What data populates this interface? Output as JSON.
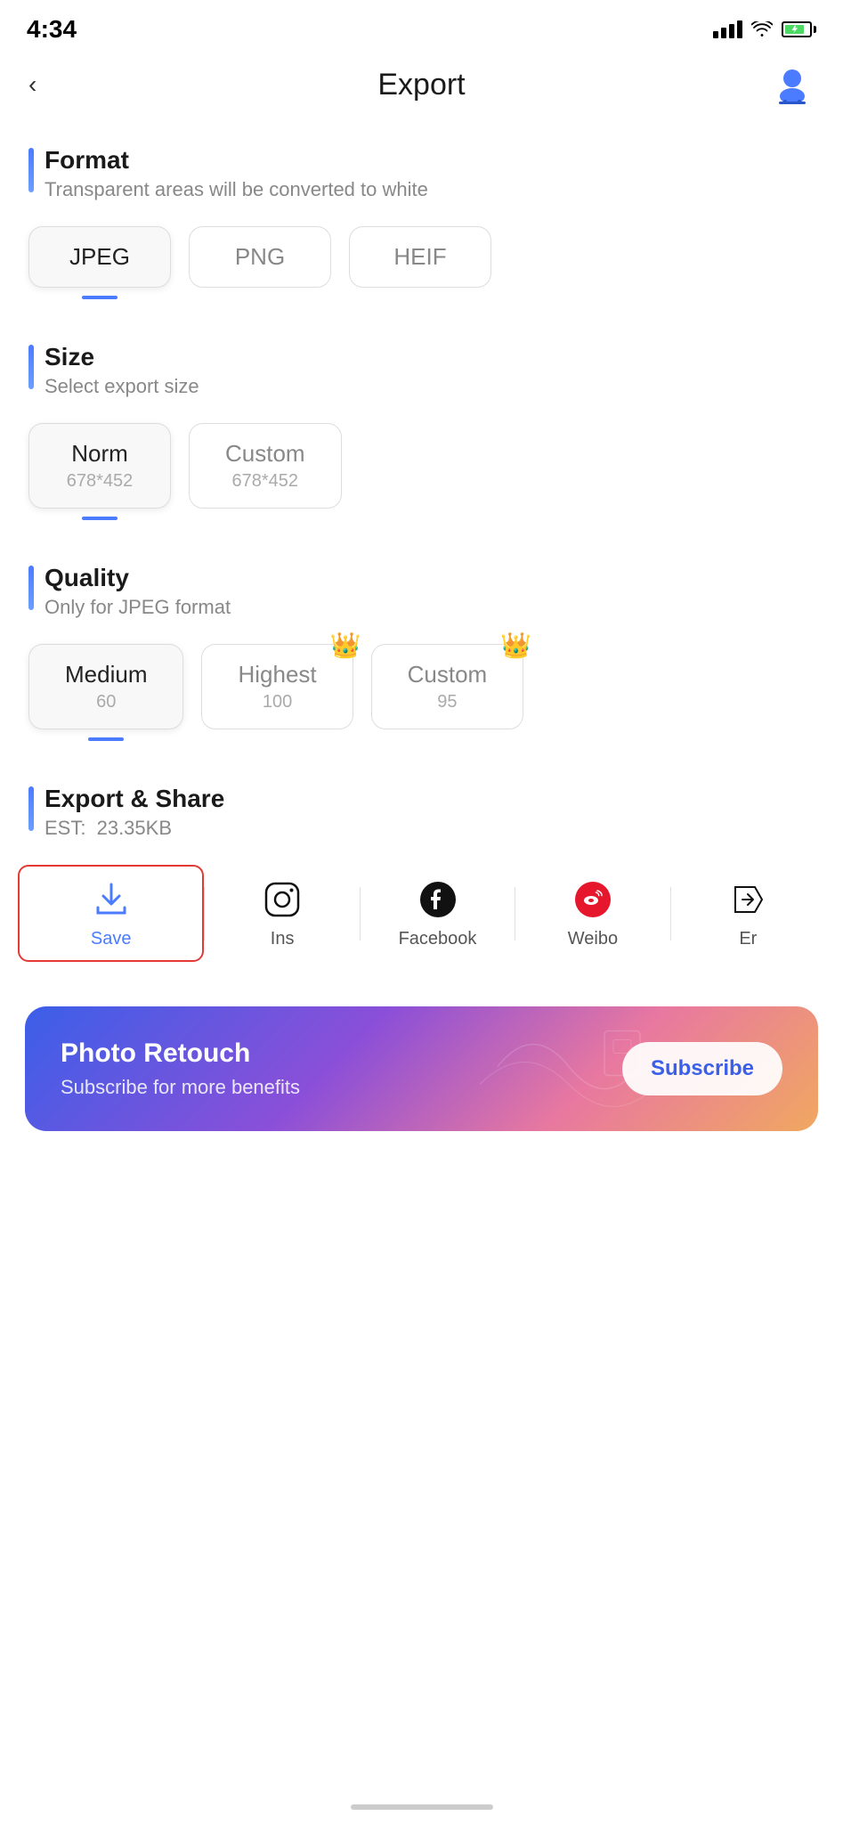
{
  "statusBar": {
    "time": "4:34",
    "batteryColor": "#4CD964"
  },
  "header": {
    "backLabel": "<",
    "title": "Export",
    "userIconAlt": "user-avatar"
  },
  "format": {
    "sectionTitle": "Format",
    "sectionSubtitle": "Transparent areas will be converted to white",
    "options": [
      {
        "label": "JPEG",
        "selected": true
      },
      {
        "label": "PNG",
        "selected": false
      },
      {
        "label": "HEIF",
        "selected": false
      }
    ]
  },
  "size": {
    "sectionTitle": "Size",
    "sectionSubtitle": "Select export size",
    "options": [
      {
        "label": "Norm",
        "sub": "678*452",
        "selected": true
      },
      {
        "label": "Custom",
        "sub": "678*452",
        "selected": false
      }
    ]
  },
  "quality": {
    "sectionTitle": "Quality",
    "sectionSubtitle": "Only for JPEG format",
    "options": [
      {
        "label": "Medium",
        "sub": "60",
        "selected": true,
        "premium": false
      },
      {
        "label": "Highest",
        "sub": "100",
        "selected": false,
        "premium": true
      },
      {
        "label": "Custom",
        "sub": "95",
        "selected": false,
        "premium": true
      }
    ]
  },
  "exportShare": {
    "sectionTitle": "Export & Share",
    "estLabel": "EST:",
    "estValue": "23.35KB",
    "shareItems": [
      {
        "id": "save",
        "label": "Save",
        "isSave": true
      },
      {
        "id": "ins",
        "label": "Ins",
        "isSave": false
      },
      {
        "id": "facebook",
        "label": "Facebook",
        "isSave": false
      },
      {
        "id": "weibo",
        "label": "Weibo",
        "isSave": false
      },
      {
        "id": "more",
        "label": "Er",
        "isSave": false
      }
    ]
  },
  "banner": {
    "title": "Photo Retouch",
    "subtitle": "Subscribe for more benefits",
    "subscribeLabel": "Subscribe"
  }
}
